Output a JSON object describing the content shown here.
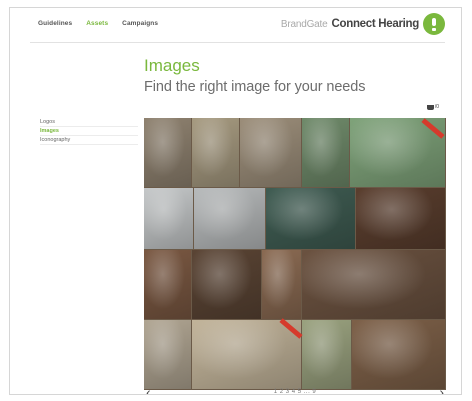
{
  "nav": {
    "items": [
      "Guidelines",
      "Assets",
      "Campaigns"
    ],
    "active": "Assets"
  },
  "brand": {
    "prefix": "BrandGate",
    "name": "Connect Hearing",
    "logo_icon": "hearing-logo",
    "accent": "#7ab83d"
  },
  "header": {
    "title": "Images",
    "subtitle": "Find the right image for your needs"
  },
  "basket": {
    "icon": "basket-icon",
    "count": "/0"
  },
  "sidebar": {
    "items": [
      {
        "label": "Logos",
        "active": false
      },
      {
        "label": "Images",
        "active": true
      },
      {
        "label": "Iconography",
        "active": false
      }
    ]
  },
  "gallery": {
    "tiles": [
      {
        "subject": "elderly man portrait in workshop",
        "tone": "#8f8270"
      },
      {
        "subject": "workshop shelves",
        "tone": "#a69a80"
      },
      {
        "subject": "elderly man smiling",
        "tone": "#9c8e7a"
      },
      {
        "subject": "man sitting on bench",
        "tone": "#6f8a6a"
      },
      {
        "subject": "two elderly men talking outdoors",
        "tone": "#7fa37a"
      },
      {
        "subject": "woman in white shirt",
        "tone": "#c5c8c9"
      },
      {
        "subject": "couple by window",
        "tone": "#b7babb"
      },
      {
        "subject": "green shutters",
        "tone": "#3f5c52"
      },
      {
        "subject": "painting on easel",
        "tone": "#5a3e2e"
      },
      {
        "subject": "wooden ornaments",
        "tone": "#7a5842"
      },
      {
        "subject": "tools on wall",
        "tone": "#5a4434"
      },
      {
        "subject": "carving tools",
        "tone": "#8a6a52"
      },
      {
        "subject": "pile of tools",
        "tone": "#6b5240"
      },
      {
        "subject": "wood carvings",
        "tone": "#b0a592"
      },
      {
        "subject": "carved face",
        "tone": "#c2b49a"
      },
      {
        "subject": "chess set close-up",
        "tone": "#9aa27f"
      },
      {
        "subject": "chess board",
        "tone": "#7d6048"
      }
    ]
  },
  "pager": {
    "prev_icon": "chevron-left-icon",
    "next_icon": "chevron-right-icon",
    "pages": "1 2 3 4 5 ... 9"
  }
}
